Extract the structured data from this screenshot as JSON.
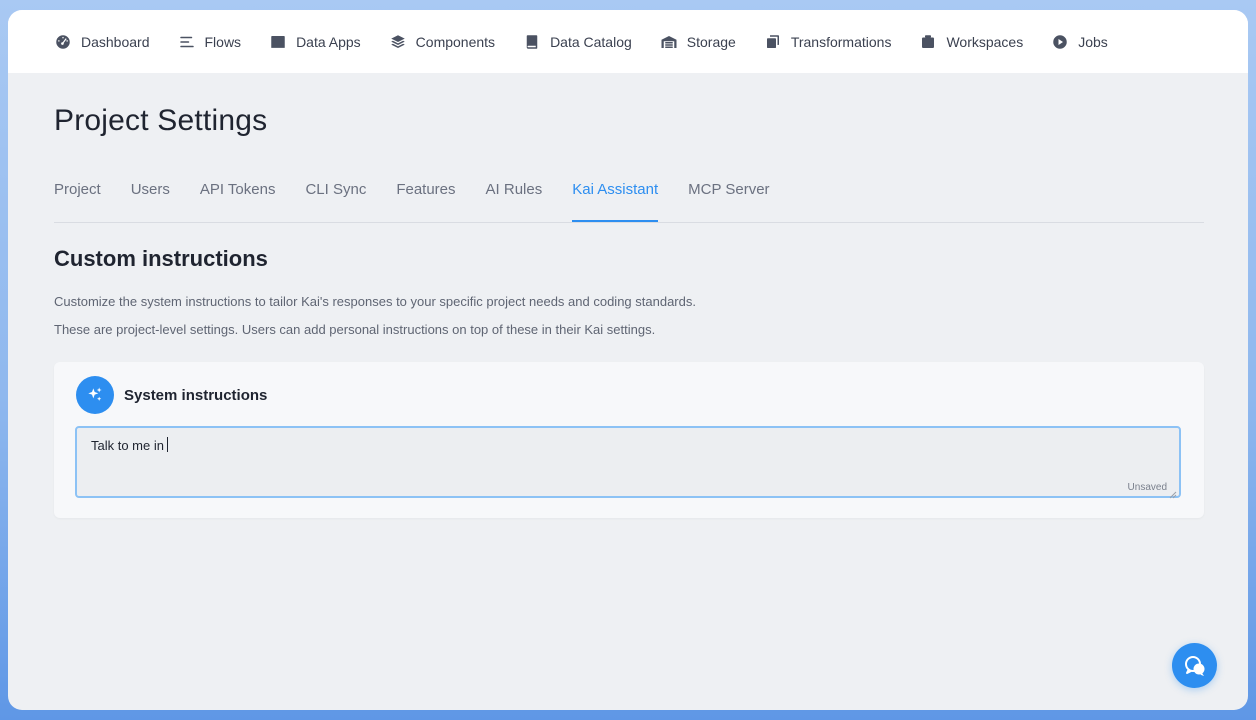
{
  "nav": {
    "items": [
      {
        "label": "Dashboard",
        "icon": "dashboard-gauge-icon"
      },
      {
        "label": "Flows",
        "icon": "flows-lines-icon"
      },
      {
        "label": "Data Apps",
        "icon": "data-apps-window-icon"
      },
      {
        "label": "Components",
        "icon": "components-layers-icon"
      },
      {
        "label": "Data Catalog",
        "icon": "data-catalog-book-icon"
      },
      {
        "label": "Storage",
        "icon": "storage-warehouse-icon"
      },
      {
        "label": "Transformations",
        "icon": "transformations-copy-icon"
      },
      {
        "label": "Workspaces",
        "icon": "workspaces-box-icon"
      },
      {
        "label": "Jobs",
        "icon": "jobs-play-icon"
      }
    ]
  },
  "page": {
    "title": "Project Settings"
  },
  "tabs": {
    "items": [
      {
        "label": "Project"
      },
      {
        "label": "Users"
      },
      {
        "label": "API Tokens"
      },
      {
        "label": "CLI Sync"
      },
      {
        "label": "Features"
      },
      {
        "label": "AI Rules"
      },
      {
        "label": "Kai Assistant"
      },
      {
        "label": "MCP Server"
      }
    ],
    "active": "Kai Assistant"
  },
  "section": {
    "title": "Custom instructions",
    "description_1": "Customize the system instructions to tailor Kai's responses to your specific project needs and coding standards.",
    "description_2": "These are project-level settings. Users can add personal instructions on top of these in their Kai settings."
  },
  "card": {
    "title": "System instructions",
    "icon": "sparkle-icon",
    "editor_value": "Talk to me in",
    "editor_status": "Unsaved"
  },
  "fab": {
    "icon": "chat-bubbles-icon"
  },
  "colors": {
    "accent": "#2d8ef0",
    "text": "#1f2430",
    "muted": "#6b7180",
    "surface": "#eef0f3"
  }
}
